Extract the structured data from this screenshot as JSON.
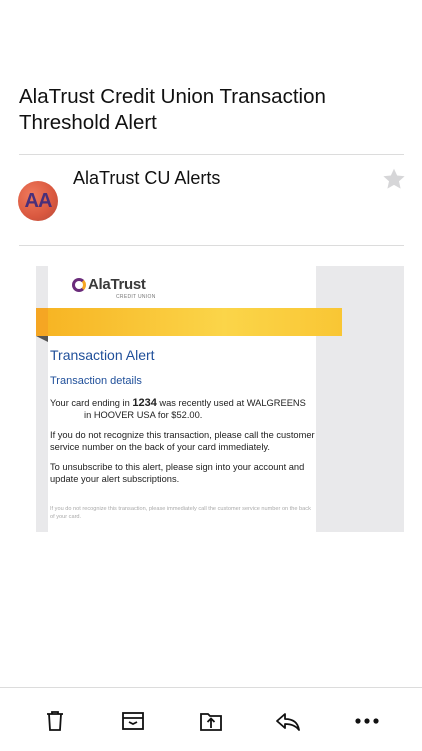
{
  "message": {
    "subject": "AlaTrust Credit Union Transaction Threshold Alert",
    "sender_initials": "AA",
    "sender_name": "AlaTrust CU Alerts"
  },
  "email_body": {
    "logo_text": "AlaTrust",
    "logo_subtext": "CREDIT UNION",
    "alert_title": "Transaction Alert",
    "details_title": "Transaction details",
    "p1_start": "Your card ending in ",
    "p1_card": "1234",
    "p1_mid": " was recently used at WALGREENS",
    "p1_end": "in HOOVER USA for $52.00.",
    "p2": "If you do not recognize this transaction, please call the customer service number on the back of your card immediately.",
    "p3": "To unsubscribe to this alert, please sign into your account and update your alert subscriptions.",
    "fine_print": "If you do not recognize this transaction, please immediately call the customer service number on the back of your card."
  },
  "toolbar": {
    "icons": [
      "trash-icon",
      "archive-icon",
      "move-icon",
      "reply-icon",
      "more-icon"
    ]
  },
  "colors": {
    "brand_blue": "#1f4f9a",
    "banner_yellow": "#f9c634",
    "brand_purple": "#6a2c7a"
  }
}
